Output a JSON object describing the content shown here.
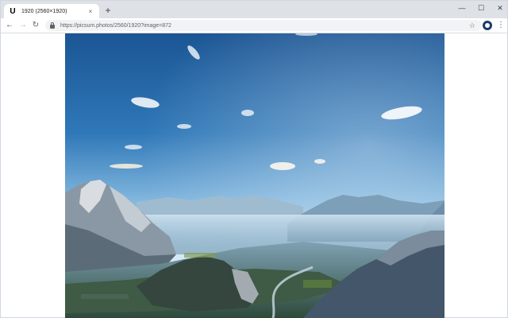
{
  "tab": {
    "favicon_letter": "U",
    "title": "1920 (2560×1920)",
    "close_glyph": "×"
  },
  "new_tab_glyph": "+",
  "window_controls": {
    "minimize": "—",
    "maximize": "☐",
    "close": "✕"
  },
  "toolbar": {
    "back_glyph": "←",
    "forward_glyph": "→",
    "reload_glyph": "↻",
    "url": "https://picsum.photos/2560/1920?image=872",
    "bookmark_glyph": "☆",
    "menu_glyph": "⋮"
  },
  "icons": {
    "favicon": "unsplash-favicon",
    "extension": "extension-icon",
    "secure": "lock-icon"
  },
  "colors": {
    "tabstrip": "#dee1e6",
    "omnibox": "#f1f3f4",
    "sky_top": "#1e5c9e",
    "sky_horizon": "#d2e6f4"
  }
}
